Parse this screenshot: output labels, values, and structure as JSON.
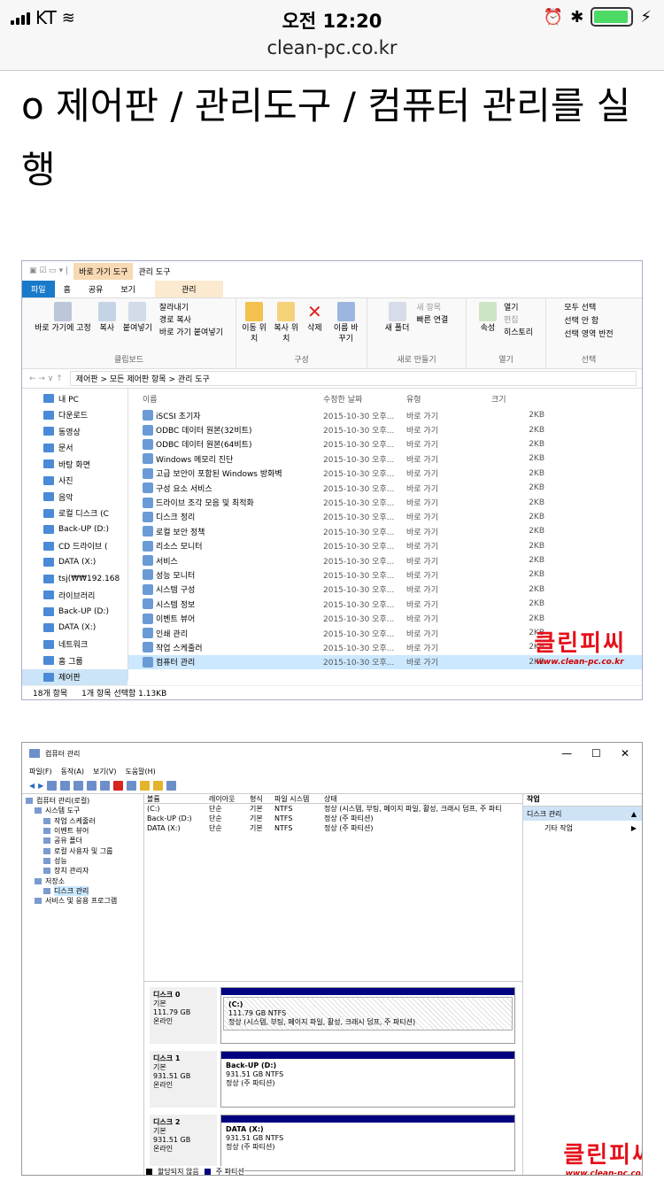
{
  "status_bar": {
    "carrier": "KT",
    "time": "오전 12:20",
    "url": "clean-pc.co.kr",
    "battery_level": 0.95
  },
  "heading": "o 제어판 / 관리도구 / 컴퓨터 관리를 실행",
  "explorer": {
    "ribbon_context_tab": "바로 가기 도구",
    "ribbon_context_title": "관리 도구",
    "tabs": [
      "파일",
      "홈",
      "공유",
      "보기",
      "관리"
    ],
    "groups": [
      {
        "name": "클립보드",
        "buttons": [
          "바로 가기에 고정",
          "복사",
          "붙여넣기"
        ],
        "small": [
          "잘라내기",
          "경로 복사",
          "바로 가기 붙여넣기"
        ]
      },
      {
        "name": "구성",
        "buttons": [
          "이동 위치",
          "복사 위치",
          "삭제",
          "이름 바꾸기"
        ]
      },
      {
        "name": "새로 만들기",
        "buttons": [
          "새 폴더"
        ],
        "small": [
          "새 항목",
          "빠른 연결"
        ]
      },
      {
        "name": "열기",
        "buttons": [
          "속성"
        ],
        "small": [
          "열기",
          "편집",
          "히스토리"
        ]
      },
      {
        "name": "선택",
        "small": [
          "모두 선택",
          "선택 안 함",
          "선택 영역 반전"
        ]
      }
    ],
    "breadcrumb": "제어판  >  모든 제어판 항목  >  관리 도구",
    "nav_items": [
      "내 PC",
      "다운로드",
      "동영상",
      "문서",
      "바탕 화면",
      "사진",
      "음악",
      "로컬 디스크 (C",
      "Back-UP (D:)",
      "CD 드라이브 (",
      "DATA (X:)",
      "tsj(₩₩192.168",
      "라이브러리",
      "Back-UP (D:)",
      "DATA (X:)",
      "네트워크",
      "홈 그룹",
      "제어판"
    ],
    "columns": [
      "이름",
      "수정한 날짜",
      "유형",
      "크기"
    ],
    "files": [
      {
        "name": "iSCSI 초기자",
        "date": "2015-10-30 오후...",
        "type": "바로 가기",
        "size": "2KB"
      },
      {
        "name": "ODBC 데이터 원본(32비트)",
        "date": "2015-10-30 오후...",
        "type": "바로 가기",
        "size": "2KB"
      },
      {
        "name": "ODBC 데이터 원본(64비트)",
        "date": "2015-10-30 오후...",
        "type": "바로 가기",
        "size": "2KB"
      },
      {
        "name": "Windows 메모리 진단",
        "date": "2015-10-30 오후...",
        "type": "바로 가기",
        "size": "2KB"
      },
      {
        "name": "고급 보안이 포함된 Windows 방화벽",
        "date": "2015-10-30 오후...",
        "type": "바로 가기",
        "size": "2KB"
      },
      {
        "name": "구성 요소 서비스",
        "date": "2015-10-30 오후...",
        "type": "바로 가기",
        "size": "2KB"
      },
      {
        "name": "드라이브 조각 모음 및 최적화",
        "date": "2015-10-30 오후...",
        "type": "바로 가기",
        "size": "2KB"
      },
      {
        "name": "디스크 정리",
        "date": "2015-10-30 오후...",
        "type": "바로 가기",
        "size": "2KB"
      },
      {
        "name": "로컬 보안 정책",
        "date": "2015-10-30 오후...",
        "type": "바로 가기",
        "size": "2KB"
      },
      {
        "name": "리소스 모니터",
        "date": "2015-10-30 오후...",
        "type": "바로 가기",
        "size": "2KB"
      },
      {
        "name": "서비스",
        "date": "2015-10-30 오후...",
        "type": "바로 가기",
        "size": "2KB"
      },
      {
        "name": "성능 모니터",
        "date": "2015-10-30 오후...",
        "type": "바로 가기",
        "size": "2KB"
      },
      {
        "name": "시스템 구성",
        "date": "2015-10-30 오후...",
        "type": "바로 가기",
        "size": "2KB"
      },
      {
        "name": "시스템 정보",
        "date": "2015-10-30 오후...",
        "type": "바로 가기",
        "size": "2KB"
      },
      {
        "name": "이벤트 뷰어",
        "date": "2015-10-30 오후...",
        "type": "바로 가기",
        "size": "2KB"
      },
      {
        "name": "인쇄 관리",
        "date": "2015-10-30 오후...",
        "type": "바로 가기",
        "size": "2KB"
      },
      {
        "name": "작업 스케줄러",
        "date": "2015-10-30 오후...",
        "type": "바로 가기",
        "size": "2KB"
      },
      {
        "name": "컴퓨터 관리",
        "date": "2015-10-30 오후...",
        "type": "바로 가기",
        "size": "2KB"
      }
    ],
    "status_count": "18개 항목",
    "status_selected": "1개 항목 선택함 1.13KB",
    "watermark": "클린피씨",
    "watermark_url": "www.clean-pc.co.kr"
  },
  "compmgmt": {
    "title": "컴퓨터 관리",
    "menu": [
      "파일(F)",
      "동작(A)",
      "보기(V)",
      "도움말(H)"
    ],
    "tree": [
      {
        "label": "컴퓨터 관리(로컬)",
        "indent": 0
      },
      {
        "label": "시스템 도구",
        "indent": 1
      },
      {
        "label": "작업 스케줄러",
        "indent": 2
      },
      {
        "label": "이벤트 뷰어",
        "indent": 2
      },
      {
        "label": "공유 폴더",
        "indent": 2
      },
      {
        "label": "로컬 사용자 및 그룹",
        "indent": 2
      },
      {
        "label": "성능",
        "indent": 2
      },
      {
        "label": "장치 관리자",
        "indent": 2
      },
      {
        "label": "저장소",
        "indent": 1
      },
      {
        "label": "디스크 관리",
        "indent": 2
      },
      {
        "label": "서비스 및 응용 프로그램",
        "indent": 1
      }
    ],
    "volume_columns": [
      "볼륨",
      "레이아웃",
      "형식",
      "파일 시스템",
      "상태"
    ],
    "volumes": [
      [
        "(C:)",
        "단순",
        "기본",
        "NTFS",
        "정상 (시스템, 부팅, 페이지 파일, 활성, 크래시 덤프, 주 파티"
      ],
      [
        "Back-UP (D:)",
        "단순",
        "기본",
        "NTFS",
        "정상 (주 파티션)"
      ],
      [
        "DATA (X:)",
        "단순",
        "기본",
        "NTFS",
        "정상 (주 파티션)"
      ]
    ],
    "disks": [
      {
        "name": "디스크 0",
        "type": "기본",
        "size": "111.79 GB",
        "state": "온라인",
        "vol": "(C:)",
        "vsize": "111.79 GB NTFS",
        "vstate": "정상 (시스템, 부팅, 페이지 파일, 활성, 크래시 덤프, 주 파티션)"
      },
      {
        "name": "디스크 1",
        "type": "기본",
        "size": "931.51 GB",
        "state": "온라인",
        "vol": "Back-UP  (D:)",
        "vsize": "931.51 GB NTFS",
        "vstate": "정상 (주 파티션)"
      },
      {
        "name": "디스크 2",
        "type": "기본",
        "size": "931.51 GB",
        "state": "온라인",
        "vol": "DATA  (X:)",
        "vsize": "931.51 GB NTFS",
        "vstate": "정상 (주 파티션)"
      }
    ],
    "legend": [
      "할당되지 않음",
      "주 파티션"
    ],
    "actions_header": "작업",
    "actions": [
      "디스크 관리",
      "기타 작업"
    ],
    "window_controls": [
      "—",
      "☐",
      "✕"
    ]
  },
  "colors": {
    "brand_red": "#e5101a",
    "partition_blue": "#020280",
    "ribbon_blue": "#1979ca"
  }
}
